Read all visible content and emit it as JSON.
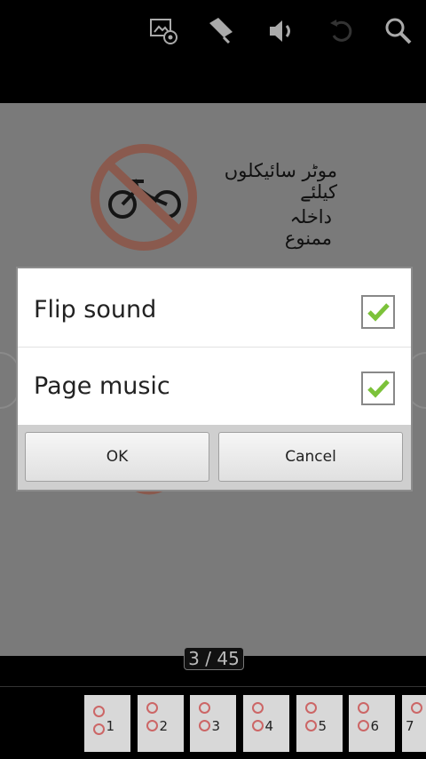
{
  "toolbar": {
    "icons": [
      "settings-icon",
      "bookmark-icon",
      "volume-icon",
      "rotate-icon",
      "search-icon"
    ]
  },
  "page": {
    "heading_line1": "موٹر سائیکلوں کیلئے",
    "heading_line2": "داخلہ ممنوع"
  },
  "page_counter": "3 / 45",
  "thumbnails": [
    {
      "number": "1"
    },
    {
      "number": "2"
    },
    {
      "number": "3"
    },
    {
      "number": "4"
    },
    {
      "number": "5"
    },
    {
      "number": "6"
    },
    {
      "number": "7"
    }
  ],
  "dialog": {
    "options": [
      {
        "label": "Flip sound",
        "checked": true
      },
      {
        "label": "Page music",
        "checked": true
      }
    ],
    "ok_label": "OK",
    "cancel_label": "Cancel"
  },
  "colors": {
    "check_color": "#7cc23a",
    "sign_red": "#c8443a"
  }
}
